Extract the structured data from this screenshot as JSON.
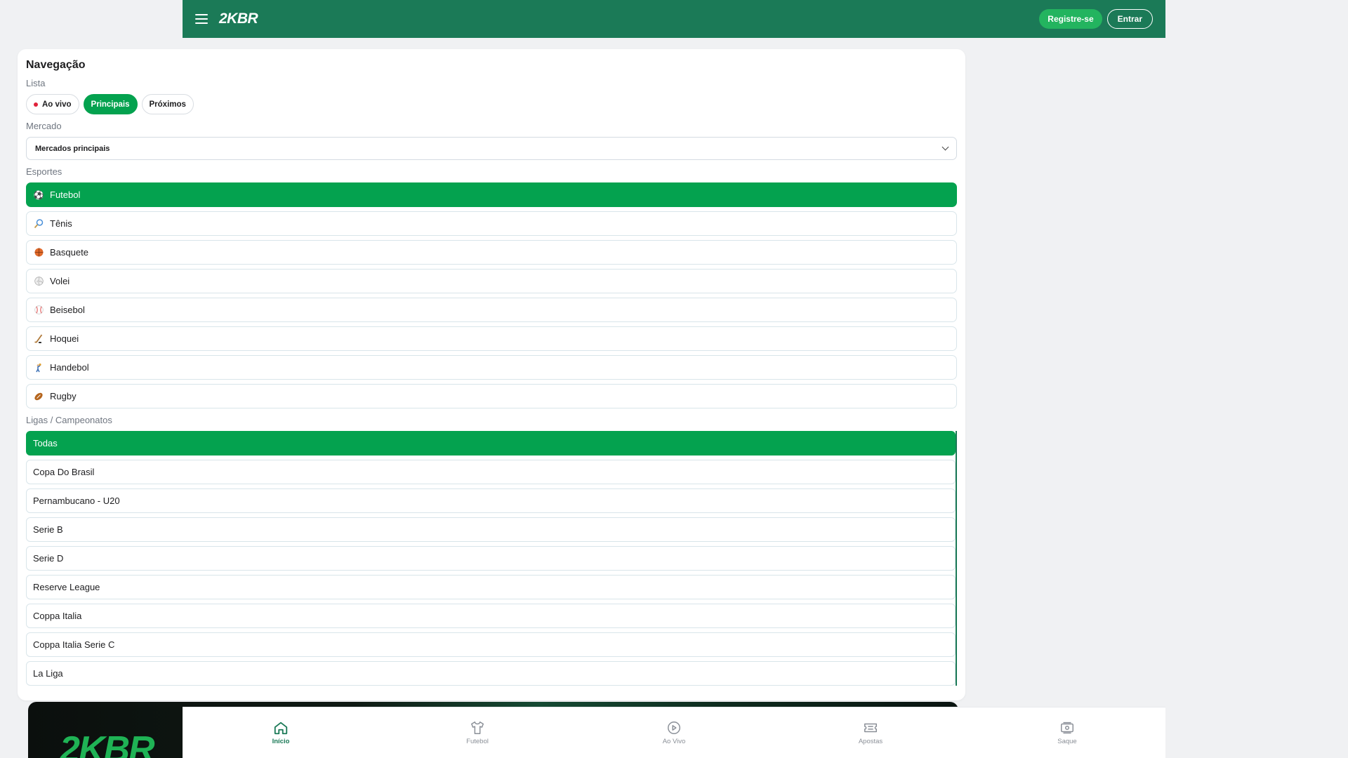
{
  "header": {
    "logo": "2KBR",
    "register_label": "Registre-se",
    "login_label": "Entrar"
  },
  "nav_panel": {
    "title": "Navegação",
    "list_label": "Lista",
    "list_tabs": [
      {
        "label": "Ao vivo",
        "active": false
      },
      {
        "label": "Principais",
        "active": true
      },
      {
        "label": "Próximos",
        "active": false
      }
    ],
    "market_label": "Mercado",
    "market_selected": "Mercados principais",
    "sports_label": "Esportes",
    "sports": [
      {
        "label": "Futebol",
        "icon": "soccer-ball-icon",
        "active": true
      },
      {
        "label": "Tênis",
        "icon": "tennis-racket-icon",
        "active": false
      },
      {
        "label": "Basquete",
        "icon": "basketball-icon",
        "active": false
      },
      {
        "label": "Volei",
        "icon": "volleyball-icon",
        "active": false
      },
      {
        "label": "Beisebol",
        "icon": "baseball-icon",
        "active": false
      },
      {
        "label": "Hoquei",
        "icon": "hockey-stick-icon",
        "active": false
      },
      {
        "label": "Handebol",
        "icon": "handball-icon",
        "active": false
      },
      {
        "label": "Rugby",
        "icon": "rugby-ball-icon",
        "active": false
      }
    ],
    "leagues_label": "Ligas / Campeonatos",
    "leagues": [
      {
        "label": "Todas",
        "active": true
      },
      {
        "label": "Copa Do Brasil",
        "active": false
      },
      {
        "label": "Pernambucano - U20",
        "active": false
      },
      {
        "label": "Serie B",
        "active": false
      },
      {
        "label": "Serie D",
        "active": false
      },
      {
        "label": "Reserve League",
        "active": false
      },
      {
        "label": "Coppa Italia",
        "active": false
      },
      {
        "label": "Coppa Italia Serie C",
        "active": false
      },
      {
        "label": "La Liga",
        "active": false
      }
    ]
  },
  "banner": {
    "logo": "2KBR"
  },
  "bottom_nav": [
    {
      "label": "Início",
      "icon": "home-icon",
      "active": true
    },
    {
      "label": "Futebol",
      "icon": "shirt-icon",
      "active": false
    },
    {
      "label": "Ao Vivo",
      "icon": "play-circle-icon",
      "active": false
    },
    {
      "label": "Apostas",
      "icon": "ticket-icon",
      "active": false
    },
    {
      "label": "Saque",
      "icon": "cash-withdraw-icon",
      "active": false
    }
  ],
  "colors": {
    "brand": "#1b7a57",
    "accent": "#04a24f",
    "live": "#e0223a"
  }
}
